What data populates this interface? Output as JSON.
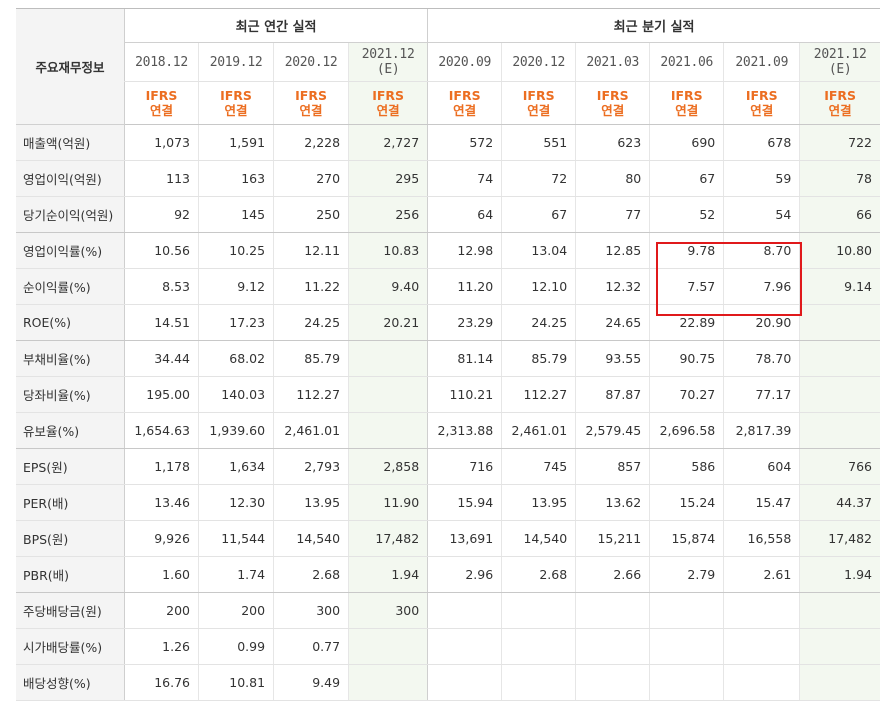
{
  "table": {
    "row_header_title": "주요재무정보",
    "group_annual": "최근 연간 실적",
    "group_quarter": "최근 분기 실적",
    "columns": [
      {
        "period": "2018.12",
        "est": "",
        "std": "IFRS",
        "consolidation": "연결"
      },
      {
        "period": "2019.12",
        "est": "",
        "std": "IFRS",
        "consolidation": "연결"
      },
      {
        "period": "2020.12",
        "est": "",
        "std": "IFRS",
        "consolidation": "연결"
      },
      {
        "period": "2021.12",
        "est": "(E)",
        "std": "IFRS",
        "consolidation": "연결"
      },
      {
        "period": "2020.09",
        "est": "",
        "std": "IFRS",
        "consolidation": "연결"
      },
      {
        "period": "2020.12",
        "est": "",
        "std": "IFRS",
        "consolidation": "연결"
      },
      {
        "period": "2021.03",
        "est": "",
        "std": "IFRS",
        "consolidation": "연결"
      },
      {
        "period": "2021.06",
        "est": "",
        "std": "IFRS",
        "consolidation": "연결"
      },
      {
        "period": "2021.09",
        "est": "",
        "std": "IFRS",
        "consolidation": "연결"
      },
      {
        "period": "2021.12",
        "est": "(E)",
        "std": "IFRS",
        "consolidation": "연결"
      }
    ],
    "rows": [
      {
        "label": "매출액(억원)",
        "values": [
          "1,073",
          "1,591",
          "2,228",
          "2,727",
          "572",
          "551",
          "623",
          "690",
          "678",
          "722"
        ]
      },
      {
        "label": "영업이익(억원)",
        "values": [
          "113",
          "163",
          "270",
          "295",
          "74",
          "72",
          "80",
          "67",
          "59",
          "78"
        ]
      },
      {
        "label": "당기순이익(억원)",
        "values": [
          "92",
          "145",
          "250",
          "256",
          "64",
          "67",
          "77",
          "52",
          "54",
          "66"
        ]
      },
      {
        "label": "영업이익률(%)",
        "values": [
          "10.56",
          "10.25",
          "12.11",
          "10.83",
          "12.98",
          "13.04",
          "12.85",
          "9.78",
          "8.70",
          "10.80"
        ]
      },
      {
        "label": "순이익률(%)",
        "values": [
          "8.53",
          "9.12",
          "11.22",
          "9.40",
          "11.20",
          "12.10",
          "12.32",
          "7.57",
          "7.96",
          "9.14"
        ]
      },
      {
        "label": "ROE(%)",
        "values": [
          "14.51",
          "17.23",
          "24.25",
          "20.21",
          "23.29",
          "24.25",
          "24.65",
          "22.89",
          "20.90",
          ""
        ]
      },
      {
        "label": "부채비율(%)",
        "values": [
          "34.44",
          "68.02",
          "85.79",
          "",
          "81.14",
          "85.79",
          "93.55",
          "90.75",
          "78.70",
          ""
        ]
      },
      {
        "label": "당좌비율(%)",
        "values": [
          "195.00",
          "140.03",
          "112.27",
          "",
          "110.21",
          "112.27",
          "87.87",
          "70.27",
          "77.17",
          ""
        ]
      },
      {
        "label": "유보율(%)",
        "values": [
          "1,654.63",
          "1,939.60",
          "2,461.01",
          "",
          "2,313.88",
          "2,461.01",
          "2,579.45",
          "2,696.58",
          "2,817.39",
          ""
        ]
      },
      {
        "label": "EPS(원)",
        "values": [
          "1,178",
          "1,634",
          "2,793",
          "2,858",
          "716",
          "745",
          "857",
          "586",
          "604",
          "766"
        ]
      },
      {
        "label": "PER(배)",
        "values": [
          "13.46",
          "12.30",
          "13.95",
          "11.90",
          "15.94",
          "13.95",
          "13.62",
          "15.24",
          "15.47",
          "44.37"
        ]
      },
      {
        "label": "BPS(원)",
        "values": [
          "9,926",
          "11,544",
          "14,540",
          "17,482",
          "13,691",
          "14,540",
          "15,211",
          "15,874",
          "16,558",
          "17,482"
        ]
      },
      {
        "label": "PBR(배)",
        "values": [
          "1.60",
          "1.74",
          "2.68",
          "1.94",
          "2.96",
          "2.68",
          "2.66",
          "2.79",
          "2.61",
          "1.94"
        ]
      },
      {
        "label": "주당배당금(원)",
        "values": [
          "200",
          "200",
          "300",
          "300",
          "",
          "",
          "",
          "",
          "",
          ""
        ]
      },
      {
        "label": "시가배당률(%)",
        "values": [
          "1.26",
          "0.99",
          "0.77",
          "",
          "",
          "",
          "",
          "",
          "",
          ""
        ]
      },
      {
        "label": "배당성향(%)",
        "values": [
          "16.76",
          "10.81",
          "9.49",
          "",
          "",
          "",
          "",
          "",
          "",
          ""
        ]
      }
    ]
  },
  "colors": {
    "ifrs_orange": "#ec6e21",
    "estimate_bg": "#f3f8f0",
    "label_bg": "#f4f4f4",
    "highlight_red": "#e0191b"
  }
}
